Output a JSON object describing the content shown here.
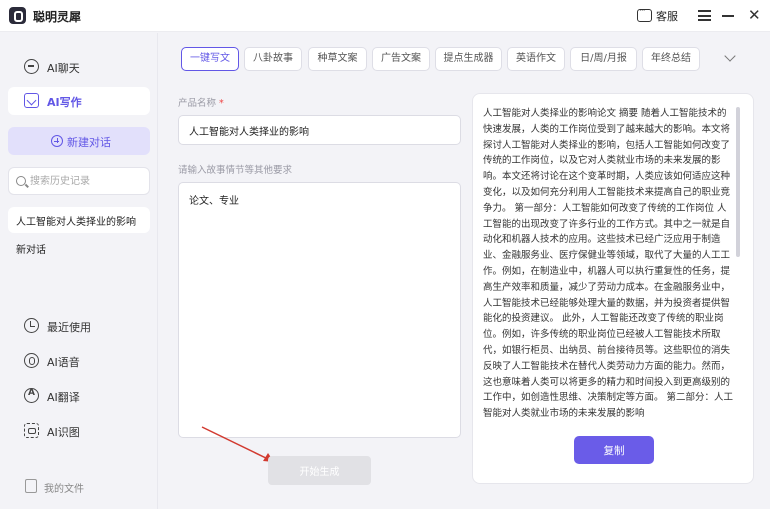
{
  "app": {
    "title": "聪明灵犀"
  },
  "titlebar": {
    "support_label": "客服"
  },
  "sidebar": {
    "nav_top": [
      {
        "label": "AI聊天",
        "icon": "chat-icon",
        "active": false
      },
      {
        "label": "AI写作",
        "icon": "write-icon",
        "active": true
      }
    ],
    "new_chat_label": "新建对话",
    "search_placeholder": "搜索历史记录",
    "conversations": [
      {
        "label": "人工智能对人类择业的影响",
        "active": true
      },
      {
        "label": "新对话",
        "active": false
      }
    ],
    "nav_bottom": [
      {
        "label": "最近使用",
        "icon": "history-icon"
      },
      {
        "label": "AI语音",
        "icon": "voice-icon"
      },
      {
        "label": "AI翻译",
        "icon": "translate-icon"
      },
      {
        "label": "AI识图",
        "icon": "scan-icon"
      }
    ],
    "my_files_label": "我的文件"
  },
  "tabs": [
    {
      "label": "一键写文",
      "active": true
    },
    {
      "label": "八卦故事",
      "active": false
    },
    {
      "label": "种草文案",
      "active": false
    },
    {
      "label": "广告文案",
      "active": false
    },
    {
      "label": "提点生成器",
      "active": false
    },
    {
      "label": "英语作文",
      "active": false
    },
    {
      "label": "日/周/月报",
      "active": false
    },
    {
      "label": "年终总结",
      "active": false
    }
  ],
  "form": {
    "product_label": "产品名称",
    "required_mark": "*",
    "product_value": "人工智能对人类择业的影响",
    "detail_label": "请输入故事情节等其他要求",
    "detail_value": "论文、专业",
    "generate_label": "开始生成"
  },
  "result": {
    "text": "人工智能对人类择业的影响论文 摘要 随着人工智能技术的快速发展，人类的工作岗位受到了越来越大的影响。本文将探讨人工智能对人类择业的影响，包括人工智能如何改变了传统的工作岗位，以及它对人类就业市场的未来发展的影响。本文还将讨论在这个变革时期，人类应该如何适应这种变化，以及如何充分利用人工智能技术来提高自己的职业竞争力。 第一部分：人工智能如何改变了传统的工作岗位 人工智能的出现改变了许多行业的工作方式。其中之一就是自动化和机器人技术的应用。这些技术已经广泛应用于制造业、金融服务业、医疗保健业等领域，取代了大量的人工工作。例如，在制造业中，机器人可以执行重复性的任务，提高生产效率和质量，减少了劳动力成本。在金融服务业中，人工智能技术已经能够处理大量的数据，并为投资者提供智能化的投资建议。 此外，人工智能还改变了传统的职业岗位。例如，许多传统的职业岗位已经被人工智能技术所取代，如银行柜员、出纳员、前台接待员等。这些职位的消失反映了人工智能技术在替代人类劳动力方面的能力。然而，这也意味着人类可以将更多的精力和时间投入到更高级别的工作中，如创造性思维、决策制定等方面。 第二部分：人工智能对人类就业市场的未来发展的影响",
    "copy_label": "复制"
  }
}
